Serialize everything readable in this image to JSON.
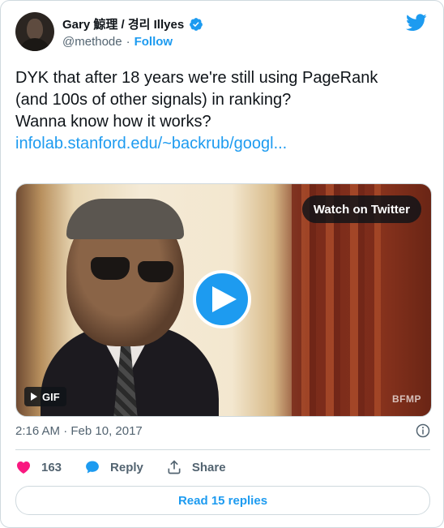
{
  "author": {
    "name": "Gary 鯨理 / 경리 Illyes",
    "handle": "@methode",
    "separator": "·",
    "follow_label": "Follow"
  },
  "tweet": {
    "line1": "DYK that after 18 years we're still using PageRank",
    "line2": "(and 100s of other signals) in ranking?",
    "line3": "Wanna know how it works?",
    "link": "infolab.stanford.edu/~backrub/googl..."
  },
  "media": {
    "watch_label": "Watch on Twitter",
    "gif_label": "GIF",
    "watermark": "BFMP"
  },
  "meta": {
    "timestamp": "2:16 AM · Feb 10, 2017"
  },
  "actions": {
    "like_count": "163",
    "reply_label": "Reply",
    "share_label": "Share"
  },
  "replies_label": "Read 15 replies",
  "colors": {
    "accent": "#1d9bf0",
    "like": "#f91880",
    "text_secondary": "#536471"
  }
}
